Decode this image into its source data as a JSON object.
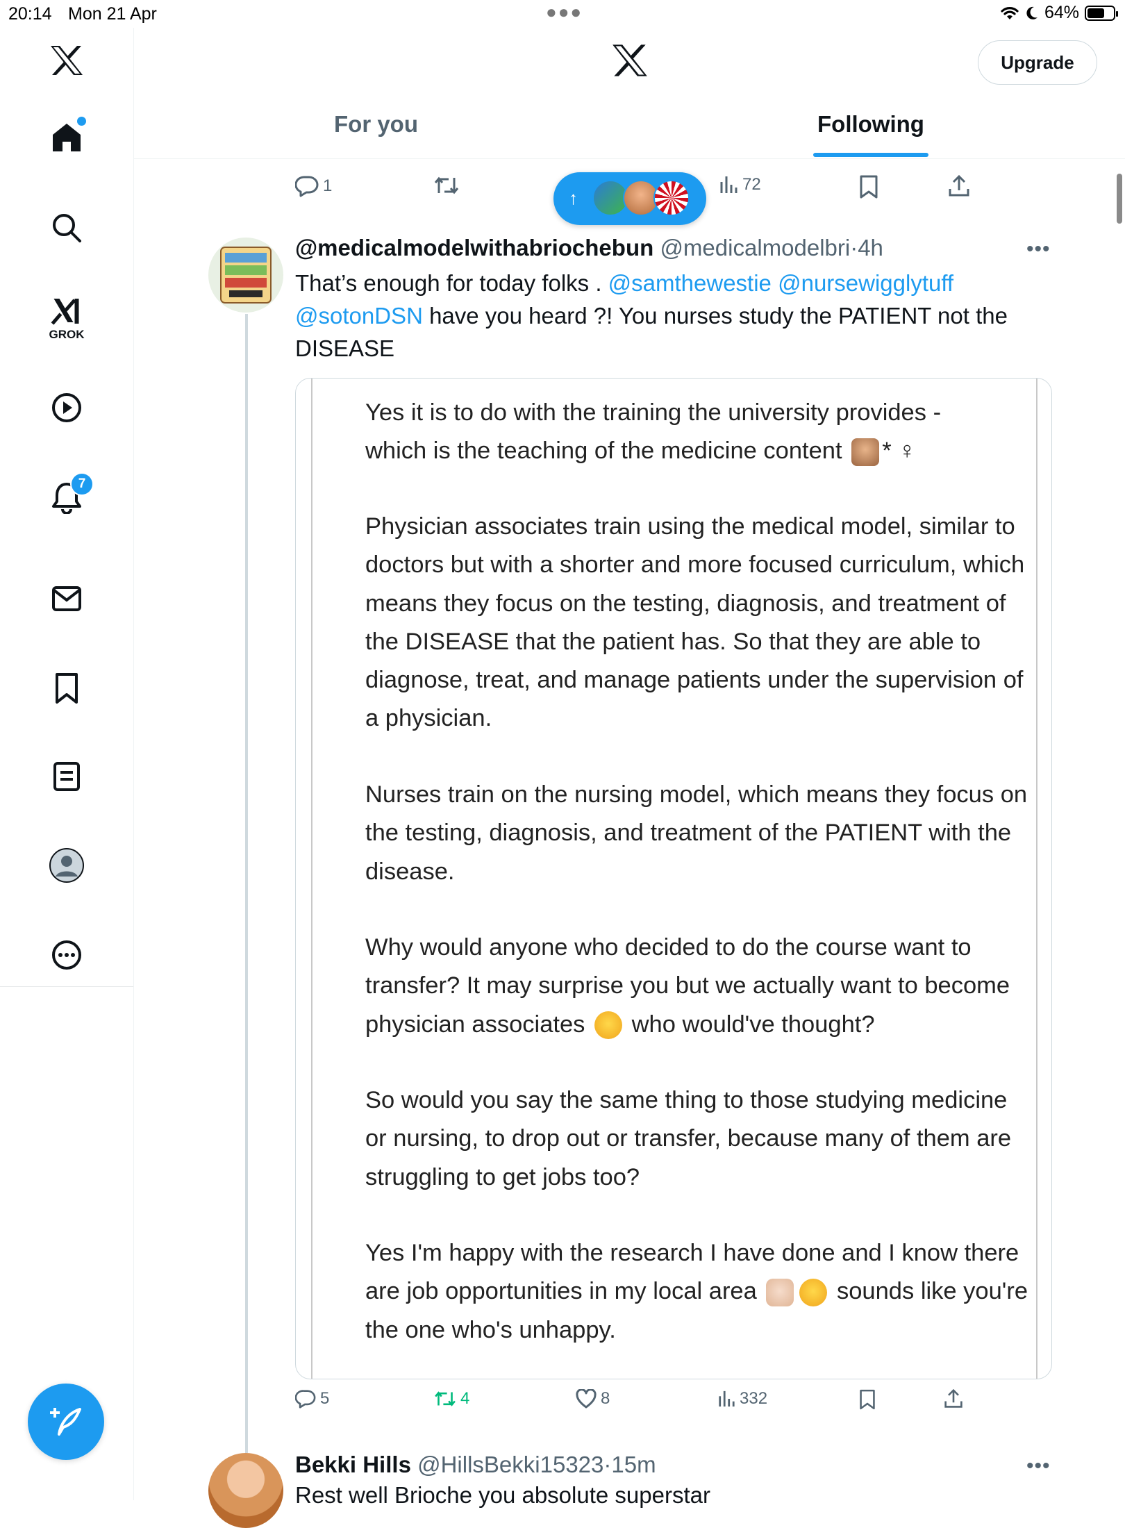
{
  "status_bar": {
    "time": "20:14",
    "date": "Mon 21 Apr",
    "battery_text": "64%"
  },
  "sidebar": {
    "grok_label": "GROK",
    "notifications_badge": "7"
  },
  "header": {
    "upgrade_label": "Upgrade",
    "tabs": [
      {
        "label": "For you",
        "active": false
      },
      {
        "label": "Following",
        "active": true
      }
    ]
  },
  "previous_post_actions": {
    "replies": "1",
    "views": "72"
  },
  "tweet": {
    "display_name": "@medicalmodelwithabriochebun",
    "handle": "@medicalmodelbri",
    "separator": "·",
    "time": "4h",
    "text_1": "That’s enough for today folks . ",
    "mention_1": "@samthewestie",
    "mention_2": "@nursewigglytuff",
    "mention_3": "@sotonDSN",
    "text_2": " have you heard ?! You nurses study the PATIENT not the DISEASE",
    "image_paragraphs": {
      "p1_a": "Yes it is to do with the training the university provides -",
      "p1_b": "which is the teaching of the medicine content",
      "p1_suffix": "* ♀",
      "p2": "Physician associates train using the medical model, similar to doctors but with a shorter and more focused curriculum, which means they focus on the testing, diagnosis, and treatment of the DISEASE that the patient has. So that they are able to diagnose, treat, and manage patients under the supervision of a physician.",
      "p3": "Nurses train on the nursing model, which means they focus on the testing, diagnosis, and treatment of the PATIENT with the disease.",
      "p4_a": "Why would anyone who decided to do the course want to transfer? It may surprise you but we actually want to become physician associates",
      "p4_b": "who would've thought?",
      "p5": "So would you say the same thing to those studying medicine or nursing, to drop out or transfer, because many of them are struggling to get jobs too?",
      "p6_a": "Yes I'm happy with the research I have done and I know there are job opportunities in my local area",
      "p6_b": "sounds like you're the one who's unhappy."
    },
    "actions": {
      "replies": "5",
      "reposts": "4",
      "likes": "8",
      "views": "332"
    },
    "colors": {
      "repost_active": "#00ba7c"
    }
  },
  "reply": {
    "display_name": "Bekki Hills",
    "handle": "@HillsBekki15323",
    "separator": "·",
    "time": "15m",
    "text": "Rest well Brioche you absolute superstar"
  },
  "colors": {
    "accent": "#1d9bf0",
    "secondary_text": "#536471"
  },
  "icons": [
    "x-logo",
    "home-icon",
    "search-icon",
    "grok-icon",
    "video-icon",
    "bell-icon",
    "mail-icon",
    "bookmark-icon",
    "list-icon",
    "profile-icon",
    "more-circle-icon",
    "compose-icon"
  ]
}
